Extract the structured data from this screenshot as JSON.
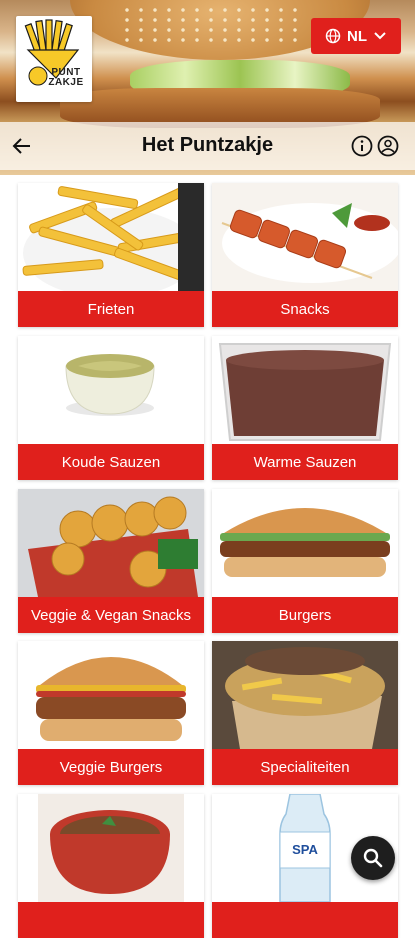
{
  "header": {
    "title": "Het Puntzakje",
    "logo_text_line1": "PUNT",
    "logo_text_line2": "ZAKJE",
    "language": "NL"
  },
  "categories": [
    {
      "label": "Frieten",
      "image": "fries-photo"
    },
    {
      "label": "Snacks",
      "image": "skewer-snack-photo"
    },
    {
      "label": "Koude Sauzen",
      "image": "cold-sauce-photo"
    },
    {
      "label": "Warme Sauzen",
      "image": "warm-sauce-photo"
    },
    {
      "label": "Veggie & Vegan Snacks",
      "image": "veggie-snacks-photo"
    },
    {
      "label": "Burgers",
      "image": "burger-photo"
    },
    {
      "label": "Veggie Burgers",
      "image": "veggie-burger-photo"
    },
    {
      "label": "Specialiteiten",
      "image": "loaded-fries-photo"
    },
    {
      "label": "",
      "image": "stew-pot-photo"
    },
    {
      "label": "",
      "image": "spa-water-bottle-photo"
    }
  ],
  "colors": {
    "accent": "#e0201c",
    "fab": "#1e1e1e"
  },
  "icons": {
    "back": "arrow-left-icon",
    "info": "info-icon",
    "account": "account-icon",
    "language": "globe-icon",
    "dropdown": "chevron-down-icon",
    "search": "search-icon"
  }
}
